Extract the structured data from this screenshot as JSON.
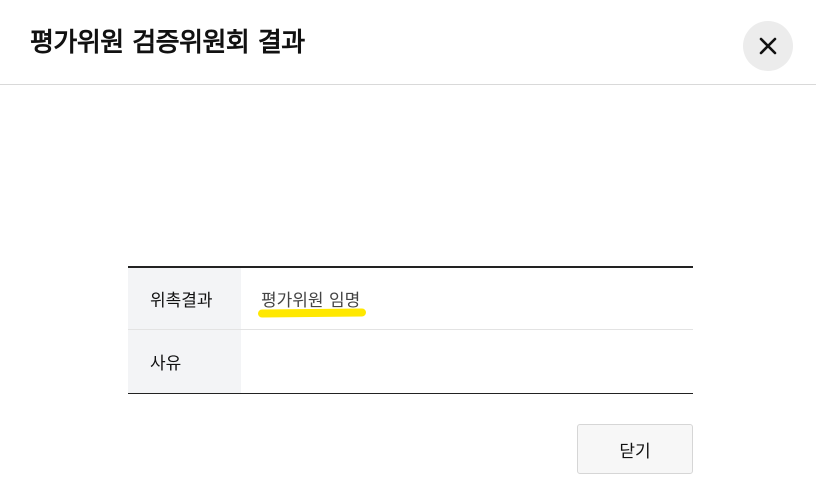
{
  "dialog": {
    "title": "평가위원 검증위원회 결과",
    "close_icon": "close-icon"
  },
  "result_table": {
    "rows": [
      {
        "label": "위촉결과",
        "value": "평가위원 임명",
        "highlight_color": "#ffe800"
      },
      {
        "label": "사유",
        "value": ""
      }
    ]
  },
  "footer": {
    "close_label": "닫기"
  }
}
